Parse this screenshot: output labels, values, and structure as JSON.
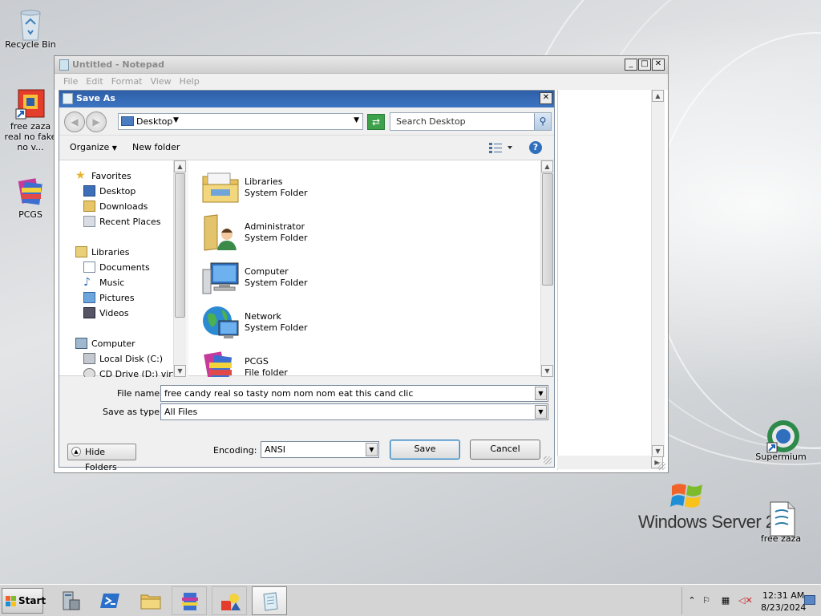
{
  "desktop": {
    "icons": [
      {
        "label": "Recycle Bin"
      },
      {
        "label": "free zaza real no fake no v..."
      },
      {
        "label": "PCGS"
      },
      {
        "label": "Supermium"
      },
      {
        "label": "free zaza"
      }
    ],
    "brand_text": "Windows Server 2"
  },
  "notepad": {
    "title": "Untitled - Notepad",
    "menu": [
      "File",
      "Edit",
      "Format",
      "View",
      "Help"
    ],
    "window_buttons": {
      "minimize": "_",
      "maximize": "□",
      "close": "✕"
    }
  },
  "save_as": {
    "title": "Save As",
    "close_glyph": "✕",
    "address": "Desktop",
    "search_placeholder": "Search Desktop",
    "toolbar": {
      "organize": "Organize",
      "new_folder": "New folder"
    },
    "nav_pane": {
      "favorites": {
        "label": "Favorites",
        "items": [
          "Desktop",
          "Downloads",
          "Recent Places"
        ]
      },
      "libraries": {
        "label": "Libraries",
        "items": [
          "Documents",
          "Music",
          "Pictures",
          "Videos"
        ]
      },
      "computer": {
        "label": "Computer",
        "items": [
          "Local Disk (C:)",
          "CD Drive (D:) virtio"
        ]
      }
    },
    "files": [
      {
        "name": "Libraries",
        "kind": "System Folder"
      },
      {
        "name": "Administrator",
        "kind": "System Folder"
      },
      {
        "name": "Computer",
        "kind": "System Folder"
      },
      {
        "name": "Network",
        "kind": "System Folder"
      },
      {
        "name": "PCGS",
        "kind": "File folder"
      }
    ],
    "file_name_label": "File name:",
    "file_name_value": "free candy real so tasty nom nom nom eat this cand clic",
    "save_type_label": "Save as type:",
    "save_type_value": "All Files",
    "hide_folders": "Hide Folders",
    "encoding_label": "Encoding:",
    "encoding_value": "ANSI",
    "save_button": "Save",
    "cancel_button": "Cancel"
  },
  "taskbar": {
    "start_label": "Start",
    "clock_time": "12:31 AM",
    "clock_date": "8/23/2024"
  },
  "colors": {
    "dialog_title": "#3465b2",
    "desktop_bg": "#d6d8db",
    "taskbar": "#d4d4d4"
  }
}
